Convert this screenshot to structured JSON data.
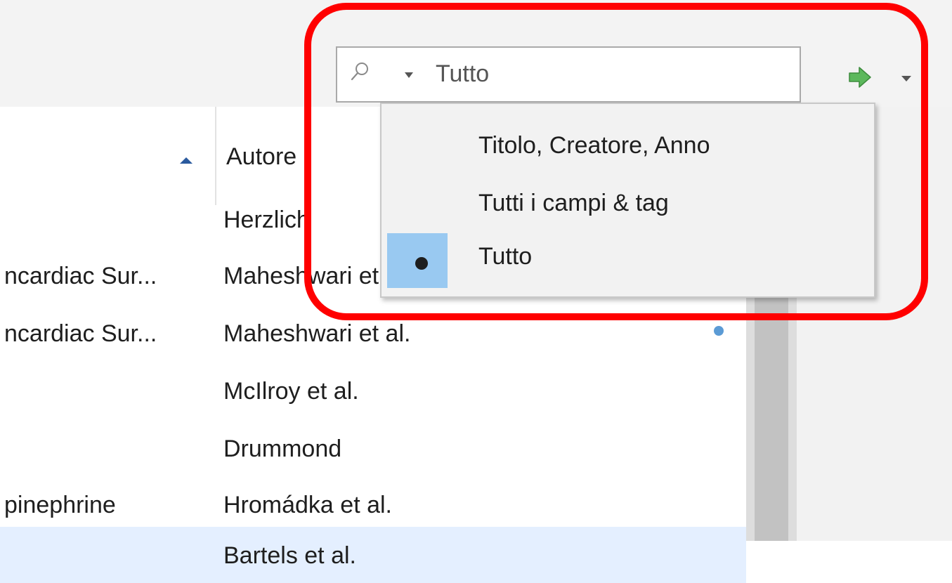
{
  "toolbar": {
    "search": {
      "mode_value": "Tutto",
      "icon": "search-icon",
      "mode_caret_icon": "caret-down-icon"
    },
    "go_button_icon": "green-arrow-right-icon",
    "go_menu_icon": "caret-down-icon"
  },
  "search_mode_menu": {
    "items": [
      {
        "label": "Titolo, Creatore, Anno",
        "selected": false
      },
      {
        "label": "Tutti i campi & tag",
        "selected": false
      },
      {
        "label": "Tutto",
        "selected": true
      }
    ],
    "selected_indicator_icon": "radio-dot-icon"
  },
  "items_list": {
    "sort_icon": "sort-ascending-icon",
    "column_header": "Autore",
    "rows": [
      {
        "title": "",
        "author": "Herzlich",
        "selected": false,
        "attachment": false
      },
      {
        "title": "ncardiac Sur...",
        "author": "Maheshwari et al.",
        "selected": false,
        "attachment": false
      },
      {
        "title": "ncardiac Sur...",
        "author": "Maheshwari et al.",
        "selected": false,
        "attachment": true
      },
      {
        "title": "",
        "author": "McIlroy et al.",
        "selected": false,
        "attachment": false
      },
      {
        "title": "",
        "author": "Drummond",
        "selected": false,
        "attachment": false
      },
      {
        "title": "pinephrine",
        "author": "Hromádka et al.",
        "selected": false,
        "attachment": false
      },
      {
        "title": "",
        "author": "Bartels et al.",
        "selected": true,
        "attachment": false
      }
    ]
  },
  "colors": {
    "highlight": "#ff0000",
    "menu_selected_gutter": "#99c9f1",
    "selected_row": "#e4efff",
    "go_arrow": "#5cb85c"
  }
}
